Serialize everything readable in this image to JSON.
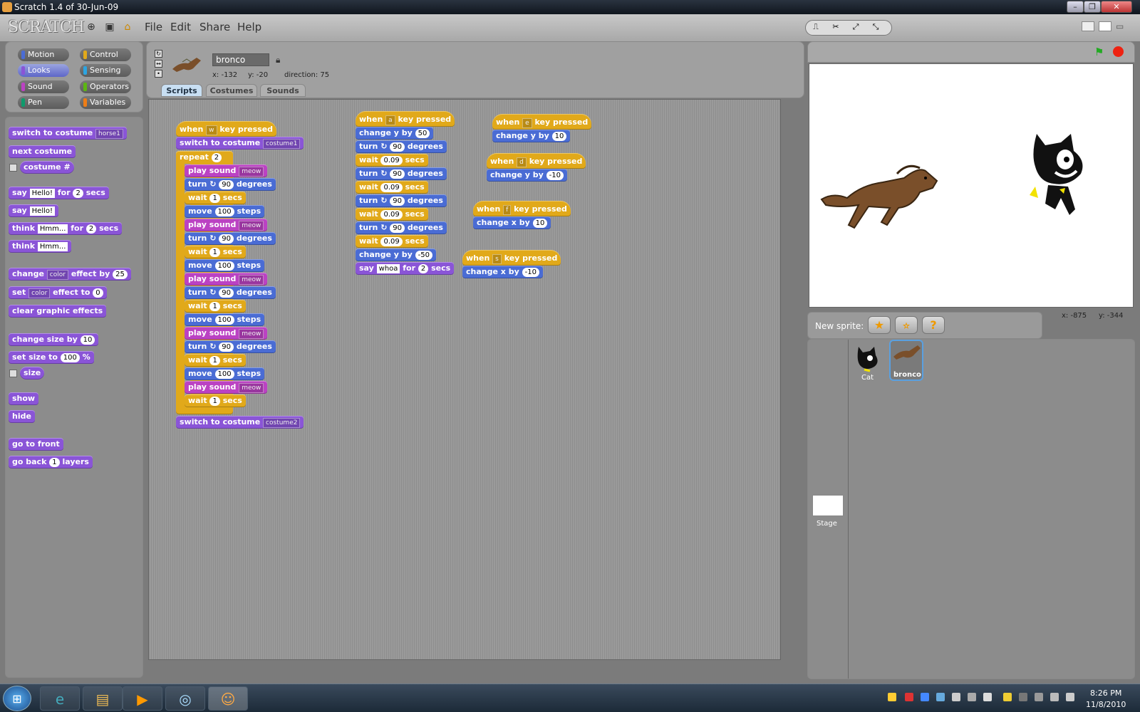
{
  "window": {
    "title": "Scratch 1.4 of 30-Jun-09"
  },
  "menubar": {
    "logo": "SCRATCH",
    "menus": [
      "File",
      "Edit",
      "Share",
      "Help"
    ]
  },
  "categories": [
    {
      "label": "Motion",
      "color": "#4a6cd4"
    },
    {
      "label": "Control",
      "color": "#e1a91a"
    },
    {
      "label": "Looks",
      "color": "#8a55d7"
    },
    {
      "label": "Sensing",
      "color": "#2ca5e2"
    },
    {
      "label": "Sound",
      "color": "#bb42c3"
    },
    {
      "label": "Operators",
      "color": "#5cb712"
    },
    {
      "label": "Pen",
      "color": "#0e9a6c"
    },
    {
      "label": "Variables",
      "color": "#ee7d16"
    }
  ],
  "palette": {
    "switch_costume": {
      "text": "switch to costume",
      "dd": "horse1"
    },
    "next_costume": "next costume",
    "costume_num": "costume #",
    "say_for": {
      "a": "say",
      "v1": "Hello!",
      "b": "for",
      "v2": "2",
      "c": "secs"
    },
    "say": {
      "a": "say",
      "v1": "Hello!"
    },
    "think_for": {
      "a": "think",
      "v1": "Hmm...",
      "b": "for",
      "v2": "2",
      "c": "secs"
    },
    "think": {
      "a": "think",
      "v1": "Hmm..."
    },
    "change_effect": {
      "a": "change",
      "dd": "color",
      "b": "effect by",
      "v": "25"
    },
    "set_effect": {
      "a": "set",
      "dd": "color",
      "b": "effect to",
      "v": "0"
    },
    "clear": "clear graphic effects",
    "change_size": {
      "a": "change size by",
      "v": "10"
    },
    "set_size": {
      "a": "set size to",
      "v": "100",
      "b": "%"
    },
    "size": "size",
    "show": "show",
    "hide": "hide",
    "go_front": "go to front",
    "go_back": {
      "a": "go back",
      "v": "1",
      "b": "layers"
    }
  },
  "sprite": {
    "name": "bronco",
    "x": "x: -132",
    "y": "y: -20",
    "direction": "direction: 75"
  },
  "tabs": [
    "Scripts",
    "Costumes",
    "Sounds"
  ],
  "scripts": {
    "w": {
      "hat": [
        "when",
        "w",
        "key pressed"
      ],
      "costume1": [
        "switch to costume",
        "costume1"
      ],
      "repeat": [
        "repeat",
        "2"
      ],
      "play": [
        "play sound",
        "meow"
      ],
      "turn": [
        "turn",
        "90",
        "degrees"
      ],
      "wait": [
        "wait",
        "1",
        "secs"
      ],
      "move": [
        "move",
        "100",
        "steps"
      ],
      "costume2": [
        "switch to costume",
        "costume2"
      ]
    },
    "a": {
      "hat": [
        "when",
        "a",
        "key pressed"
      ],
      "cy": [
        "change y by",
        "50"
      ],
      "turn": [
        "turn",
        "90",
        "degrees"
      ],
      "wait": [
        "wait",
        "0.09",
        "secs"
      ],
      "cy2": [
        "change y by",
        "-50"
      ],
      "say": [
        "say",
        "whoa",
        "for",
        "2",
        "secs"
      ]
    },
    "e": {
      "hat": [
        "when",
        "e",
        "key pressed"
      ],
      "b": [
        "change y by",
        "10"
      ]
    },
    "d": {
      "hat": [
        "when",
        "d",
        "key pressed"
      ],
      "b": [
        "change y by",
        "-10"
      ]
    },
    "f": {
      "hat": [
        "when",
        "f",
        "key pressed"
      ],
      "b": [
        "change x by",
        "10"
      ]
    },
    "s": {
      "hat": [
        "when",
        "s",
        "key pressed"
      ],
      "b": [
        "change x by",
        "-10"
      ]
    }
  },
  "stage": {
    "mouse_x": "x: -875",
    "mouse_y": "y: -344"
  },
  "newsprite": {
    "label": "New sprite:"
  },
  "sprites": [
    {
      "name": "Cat"
    },
    {
      "name": "bronco"
    }
  ],
  "stage_thumb": "Stage",
  "clock": {
    "time": "8:26 PM",
    "date": "11/8/2010"
  }
}
